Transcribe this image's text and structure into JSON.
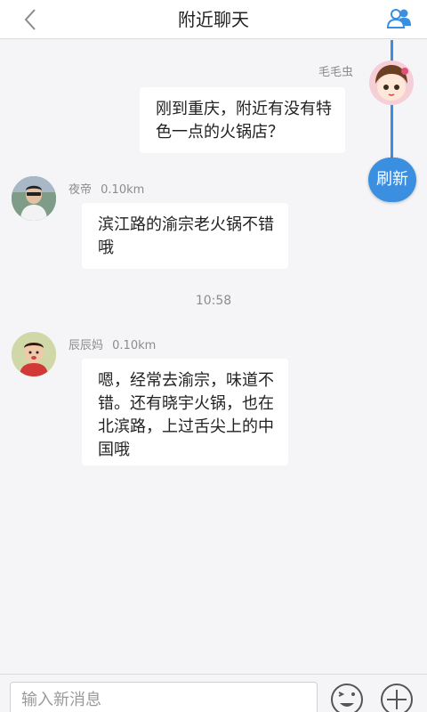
{
  "header": {
    "title": "附近聊天",
    "back_icon": "chevron-left-icon",
    "contacts_icon": "contacts-icon"
  },
  "refresh": {
    "label": "刷新"
  },
  "messages": [
    {
      "nickname": "毛毛虫",
      "distance": "",
      "text_lines": [
        "刚到重庆，附近有没有特",
        "色一点的火锅店？"
      ],
      "side": "right"
    },
    {
      "nickname": "夜帝",
      "distance": "0.10km",
      "text_lines": [
        "滨江路的渝宗老火锅不错",
        "哦"
      ],
      "side": "left"
    },
    {
      "nickname": "辰辰妈",
      "distance": "0.10km",
      "text_lines": [
        "嗯，经常去渝宗，味道不",
        "错。还有晓宇火锅，也在",
        "北滨路，上过舌尖上的中",
        "国哦"
      ],
      "side": "left"
    }
  ],
  "timestamp": "10:58",
  "composer": {
    "placeholder": "输入新消息",
    "emoji_icon": "emoji-icon",
    "plus_icon": "plus-circle-icon"
  },
  "colors": {
    "accent": "#3b8fe0",
    "background": "#f5f5f7",
    "bubble": "#ffffff"
  }
}
